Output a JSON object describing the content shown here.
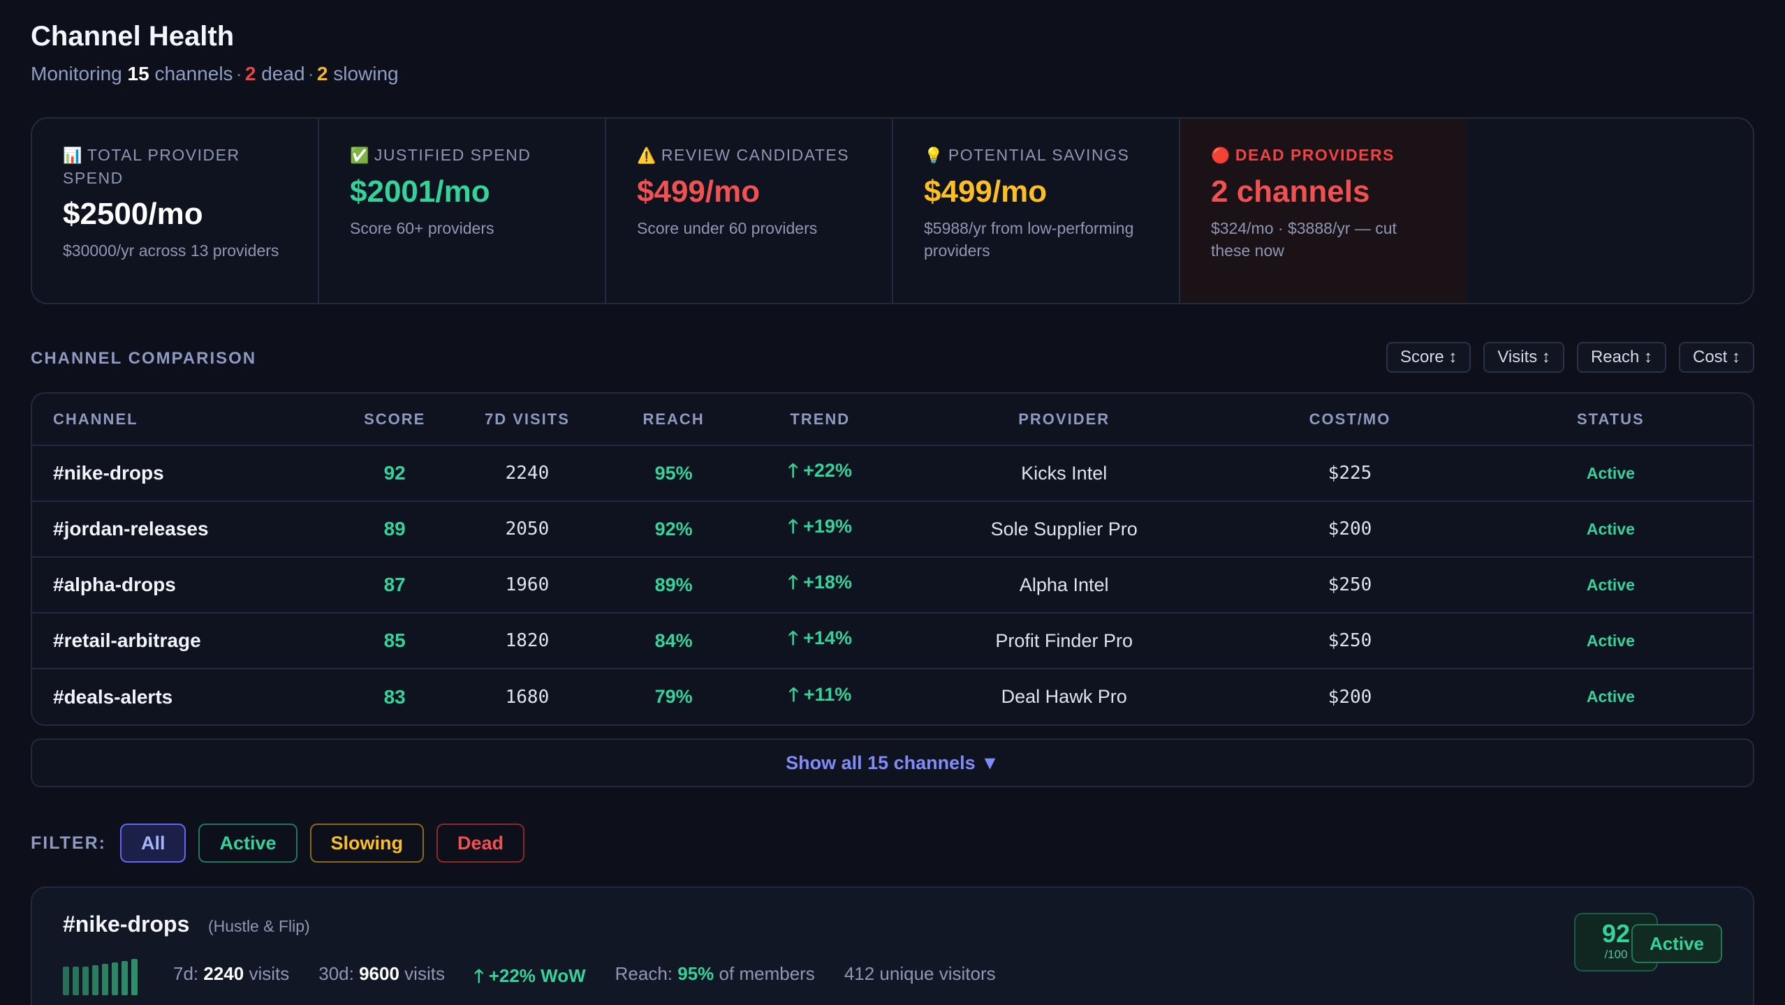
{
  "header": {
    "title": "Channel Health",
    "monitoring_prefix": "Monitoring",
    "channel_count": "15",
    "channels_word": "channels",
    "dead_count": "2",
    "dead_word": "dead",
    "slowing_count": "2",
    "slowing_word": "slowing"
  },
  "summary": [
    {
      "icon": "📊",
      "label": "TOTAL PROVIDER SPEND",
      "value": "$2500/mo",
      "sub": "$30000/yr across 13 providers",
      "color": "#ffffff"
    },
    {
      "icon": "✅",
      "label": "JUSTIFIED SPEND",
      "value": "$2001/mo",
      "sub": "Score 60+ providers",
      "color": "#34d399"
    },
    {
      "icon": "⚠️",
      "label": "REVIEW CANDIDATES",
      "value": "$499/mo",
      "sub": "Score under 60 providers",
      "color": "#f05252"
    },
    {
      "icon": "💡",
      "label": "POTENTIAL SAVINGS",
      "value": "$499/mo",
      "sub": "$5988/yr from low-performing providers",
      "color": "#fbbf24"
    },
    {
      "icon": "🔴",
      "label": "DEAD PROVIDERS",
      "value": "2 channels",
      "sub": "$324/mo · $3888/yr — cut these now",
      "color": "#f05252"
    }
  ],
  "comparison": {
    "title": "CHANNEL COMPARISON",
    "sort_buttons": [
      "Score ↕",
      "Visits ↕",
      "Reach ↕",
      "Cost ↕"
    ],
    "columns": [
      "CHANNEL",
      "SCORE",
      "7D VISITS",
      "REACH",
      "TREND",
      "PROVIDER",
      "COST/MO",
      "STATUS"
    ],
    "rows": [
      {
        "channel": "#nike-drops",
        "score": "92",
        "visits": "2240",
        "reach": "95%",
        "trend": "🡑 +22%",
        "provider": "Kicks Intel",
        "cost": "$225",
        "status": "Active"
      },
      {
        "channel": "#jordan-releases",
        "score": "89",
        "visits": "2050",
        "reach": "92%",
        "trend": "🡑 +19%",
        "provider": "Sole Supplier Pro",
        "cost": "$200",
        "status": "Active"
      },
      {
        "channel": "#alpha-drops",
        "score": "87",
        "visits": "1960",
        "reach": "89%",
        "trend": "🡑 +18%",
        "provider": "Alpha Intel",
        "cost": "$250",
        "status": "Active"
      },
      {
        "channel": "#retail-arbitrage",
        "score": "85",
        "visits": "1820",
        "reach": "84%",
        "trend": "🡑 +14%",
        "provider": "Profit Finder Pro",
        "cost": "$250",
        "status": "Active"
      },
      {
        "channel": "#deals-alerts",
        "score": "83",
        "visits": "1680",
        "reach": "79%",
        "trend": "🡑 +11%",
        "provider": "Deal Hawk Pro",
        "cost": "$200",
        "status": "Active"
      }
    ],
    "show_all_label": "Show all 15 channels ▼"
  },
  "filter": {
    "label": "FILTER:",
    "options": [
      "All",
      "Active",
      "Slowing",
      "Dead"
    ],
    "selected": "All"
  },
  "detail": {
    "name": "#nike-drops",
    "group": "(Hustle & Flip)",
    "label_7d": "7d:",
    "visits_7d": "2240",
    "visits_word": "visits",
    "label_30d": "30d:",
    "visits_30d": "9600",
    "wow": "🡑 +22% WoW",
    "reach_label": "Reach:",
    "reach_value": "95%",
    "reach_suffix": "of members",
    "unique_visitors": "412 unique visitors",
    "score": "92",
    "score_denominator": "/100",
    "status": "Active",
    "spark_levels": [
      0.78,
      0.78,
      0.78,
      0.82,
      0.86,
      0.9,
      0.94,
      1.0
    ]
  }
}
